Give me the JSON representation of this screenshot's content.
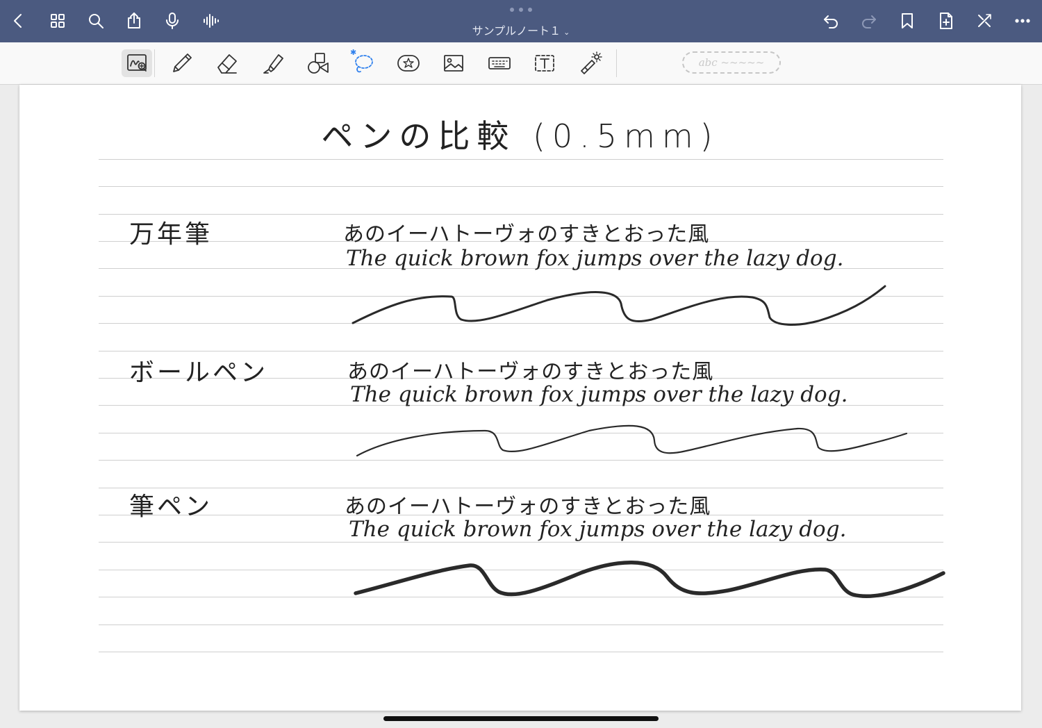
{
  "window": {
    "title": "サンプルノート１",
    "title_chevron": "⌄"
  },
  "topbar": {
    "left_icons": [
      "back-chevron-icon",
      "thumbnails-grid-icon",
      "search-icon",
      "share-icon",
      "microphone-icon",
      "audio-waveform-icon"
    ],
    "right_icons": [
      "undo-icon",
      "redo-icon",
      "bookmark-icon",
      "add-page-icon",
      "close-toolbar-icon",
      "more-icon"
    ]
  },
  "toolbar": {
    "tools": [
      "zoom-window-icon",
      "pen-icon",
      "eraser-icon",
      "highlighter-icon",
      "shapes-icon",
      "lasso-icon",
      "sticker-icon",
      "image-icon",
      "keyboard-icon",
      "text-box-icon",
      "laser-pointer-icon"
    ],
    "selected_tool": "zoom-window-icon",
    "lasso_badge": "✱",
    "handwriting_placeholder": "abc ~~~~~"
  },
  "note": {
    "title": "ペンの比較 (0.5mm)",
    "sections": [
      {
        "label": "万年筆",
        "jp_text": "あのイーハトーヴォのすきとおった風",
        "en_text": "The quick brown fox jumps over the lazy dog."
      },
      {
        "label": "ボールペン",
        "jp_text": "あのイーハトーヴォのすきとおった風",
        "en_text": "The quick brown fox jumps over the lazy dog."
      },
      {
        "label": "筆ペン",
        "jp_text": "あのイーハトーヴォのすきとおった風",
        "en_text": "The quick brown fox jumps over the lazy dog."
      }
    ]
  },
  "colors": {
    "topbar": "#4b5a80",
    "ink": "#222222",
    "accent": "#2f80ed"
  }
}
